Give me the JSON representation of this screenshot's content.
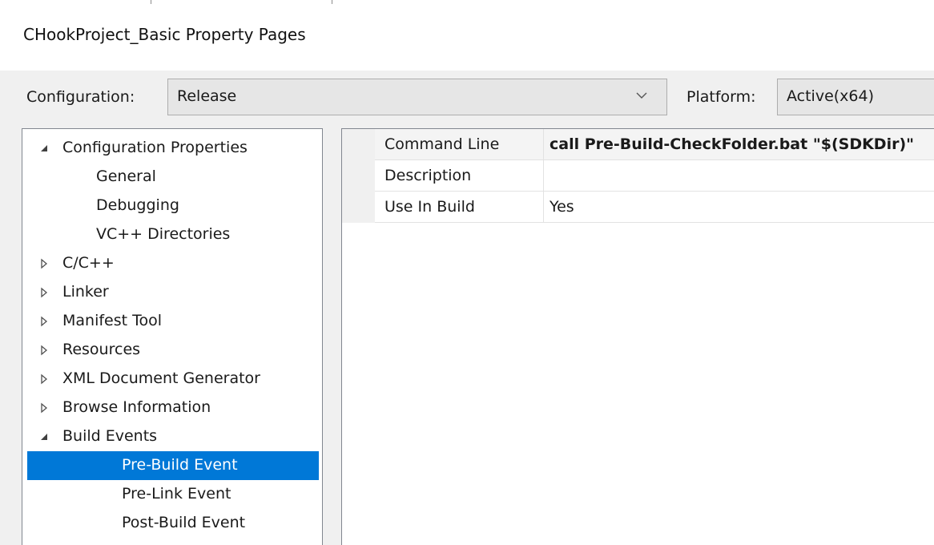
{
  "window": {
    "title": "CHookProject_Basic Property Pages"
  },
  "configuration": {
    "label": "Configuration:",
    "value": "Release"
  },
  "platform": {
    "label": "Platform:",
    "value": "Active(x64)"
  },
  "tree": {
    "items": [
      {
        "label": "Configuration Properties",
        "level": 0,
        "glyph": "expanded",
        "selected": false
      },
      {
        "label": "General",
        "level": 1,
        "glyph": "none",
        "selected": false
      },
      {
        "label": "Debugging",
        "level": 1,
        "glyph": "none",
        "selected": false
      },
      {
        "label": "VC++ Directories",
        "level": 1,
        "glyph": "none",
        "selected": false
      },
      {
        "label": "C/C++",
        "level": 0.5,
        "glyph": "collapsed",
        "selected": false
      },
      {
        "label": "Linker",
        "level": 0.5,
        "glyph": "collapsed",
        "selected": false
      },
      {
        "label": "Manifest Tool",
        "level": 0.5,
        "glyph": "collapsed",
        "selected": false
      },
      {
        "label": "Resources",
        "level": 0.5,
        "glyph": "collapsed",
        "selected": false
      },
      {
        "label": "XML Document Generator",
        "level": 0.5,
        "glyph": "collapsed",
        "selected": false
      },
      {
        "label": "Browse Information",
        "level": 0.5,
        "glyph": "collapsed",
        "selected": false
      },
      {
        "label": "Build Events",
        "level": 0.5,
        "glyph": "expanded",
        "selected": false
      },
      {
        "label": "Pre-Build Event",
        "level": 2,
        "glyph": "none",
        "selected": true
      },
      {
        "label": "Pre-Link Event",
        "level": 2,
        "glyph": "none",
        "selected": false
      },
      {
        "label": "Post-Build Event",
        "level": 2,
        "glyph": "none",
        "selected": false
      }
    ]
  },
  "properties": {
    "rows": [
      {
        "name": "Command Line",
        "value": "call Pre-Build-CheckFolder.bat \"$(SDKDir)\"",
        "bold": true
      },
      {
        "name": "Description",
        "value": "",
        "bold": false
      },
      {
        "name": "Use In Build",
        "value": "Yes",
        "bold": false
      }
    ]
  },
  "colors": {
    "selection": "#0078d7",
    "combo_background": "#e6e6e6",
    "dialog_background": "#f0f0f0"
  }
}
